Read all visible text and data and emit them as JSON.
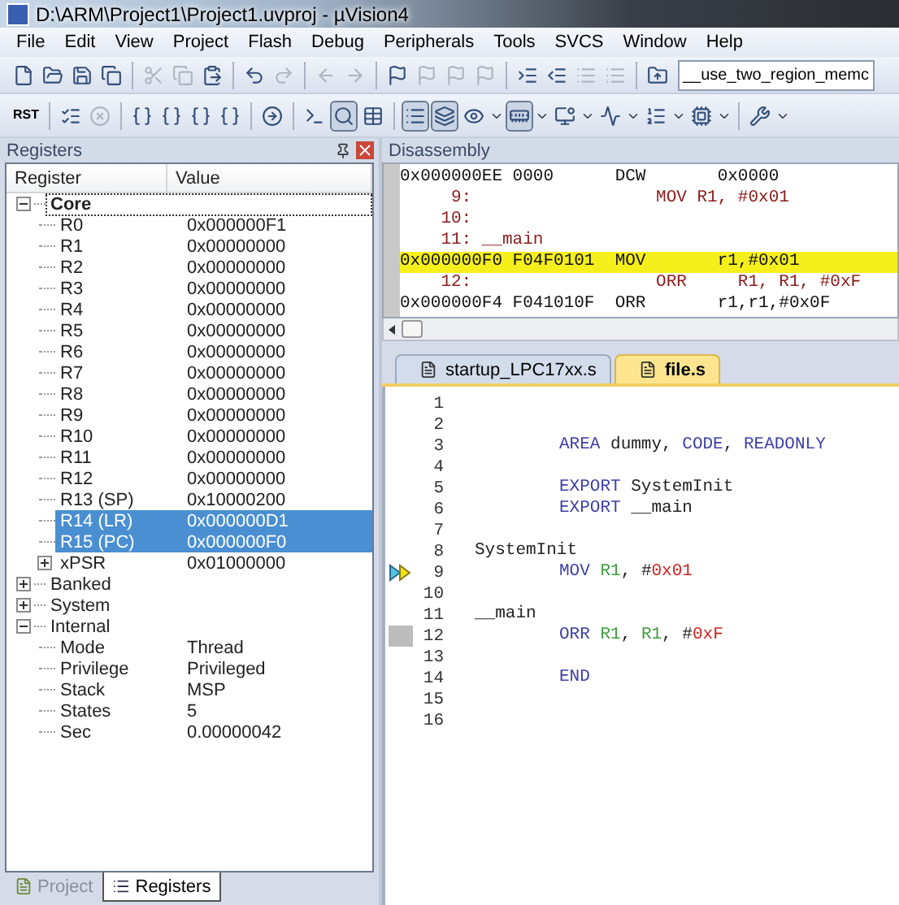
{
  "window": {
    "title": "D:\\ARM\\Project1\\Project1.uvproj - µVision4"
  },
  "menu": [
    "File",
    "Edit",
    "View",
    "Project",
    "Flash",
    "Debug",
    "Peripherals",
    "Tools",
    "SVCS",
    "Window",
    "Help"
  ],
  "toolbar_1": [
    {
      "kind": "new",
      "disabled": false
    },
    {
      "kind": "open",
      "disabled": false
    },
    {
      "kind": "save",
      "disabled": false
    },
    {
      "kind": "save-all",
      "disabled": false
    },
    {
      "kind": "sep"
    },
    {
      "kind": "cut",
      "disabled": true
    },
    {
      "kind": "copy",
      "disabled": true
    },
    {
      "kind": "paste",
      "disabled": false
    },
    {
      "kind": "sep"
    },
    {
      "kind": "undo",
      "disabled": false
    },
    {
      "kind": "redo",
      "disabled": true
    },
    {
      "kind": "sep"
    },
    {
      "kind": "back",
      "disabled": true
    },
    {
      "kind": "forward",
      "disabled": true
    },
    {
      "kind": "sep"
    },
    {
      "kind": "bookmark",
      "disabled": false
    },
    {
      "kind": "bookmark-prev",
      "disabled": true
    },
    {
      "kind": "bookmark-next",
      "disabled": true
    },
    {
      "kind": "bookmark-clear",
      "disabled": true
    },
    {
      "kind": "sep"
    },
    {
      "kind": "indent",
      "disabled": false
    },
    {
      "kind": "unindent",
      "disabled": false
    },
    {
      "kind": "comment",
      "disabled": true
    },
    {
      "kind": "uncomment",
      "disabled": true
    },
    {
      "kind": "sep"
    },
    {
      "kind": "load",
      "disabled": false
    }
  ],
  "target_select": {
    "value": "__use_two_region_memc"
  },
  "toolbar_2": [
    {
      "kind": "reset",
      "label": "RST",
      "disabled": false
    },
    {
      "kind": "sep"
    },
    {
      "kind": "run",
      "disabled": false
    },
    {
      "kind": "stop",
      "disabled": true
    },
    {
      "kind": "sep"
    },
    {
      "kind": "step-into",
      "disabled": false
    },
    {
      "kind": "step-over",
      "disabled": false
    },
    {
      "kind": "step-out",
      "disabled": false
    },
    {
      "kind": "run-to-cursor",
      "disabled": false
    },
    {
      "kind": "sep"
    },
    {
      "kind": "next-statement",
      "disabled": false
    },
    {
      "kind": "sep"
    },
    {
      "kind": "command",
      "disabled": false,
      "pressed": false
    },
    {
      "kind": "disassembly",
      "disabled": false,
      "pressed": true
    },
    {
      "kind": "symbols",
      "disabled": false,
      "pressed": false
    },
    {
      "kind": "sep"
    },
    {
      "kind": "registers",
      "disabled": false,
      "pressed": true
    },
    {
      "kind": "call-stack",
      "disabled": false,
      "pressed": true
    },
    {
      "kind": "watch",
      "disabled": false,
      "pressed": false,
      "dropdown": true
    },
    {
      "kind": "memory",
      "disabled": false,
      "pressed": true,
      "dropdown": true
    },
    {
      "kind": "serial",
      "disabled": false,
      "pressed": false,
      "dropdown": true
    },
    {
      "kind": "analysis",
      "disabled": false,
      "pressed": false,
      "dropdown": true
    },
    {
      "kind": "trace",
      "disabled": false,
      "pressed": false,
      "dropdown": true
    },
    {
      "kind": "system-viewer",
      "disabled": false,
      "pressed": false,
      "dropdown": true
    },
    {
      "kind": "sep"
    },
    {
      "kind": "tools",
      "disabled": false,
      "pressed": false,
      "dropdown": true
    }
  ],
  "registers": {
    "title": "Registers",
    "columns": [
      "Register",
      "Value"
    ],
    "tree": [
      {
        "name": "Core",
        "expanded": true,
        "focused": true,
        "children": [
          {
            "name": "R0",
            "value": "0x000000F1",
            "selected": false
          },
          {
            "name": "R1",
            "value": "0x00000000",
            "selected": false
          },
          {
            "name": "R2",
            "value": "0x00000000",
            "selected": false
          },
          {
            "name": "R3",
            "value": "0x00000000",
            "selected": false
          },
          {
            "name": "R4",
            "value": "0x00000000",
            "selected": false
          },
          {
            "name": "R5",
            "value": "0x00000000",
            "selected": false
          },
          {
            "name": "R6",
            "value": "0x00000000",
            "selected": false
          },
          {
            "name": "R7",
            "value": "0x00000000",
            "selected": false
          },
          {
            "name": "R8",
            "value": "0x00000000",
            "selected": false
          },
          {
            "name": "R9",
            "value": "0x00000000",
            "selected": false
          },
          {
            "name": "R10",
            "value": "0x00000000",
            "selected": false
          },
          {
            "name": "R11",
            "value": "0x00000000",
            "selected": false
          },
          {
            "name": "R12",
            "value": "0x00000000",
            "selected": false
          },
          {
            "name": "R13 (SP)",
            "value": "0x10000200",
            "selected": false
          },
          {
            "name": "R14 (LR)",
            "value": "0x000000D1",
            "selected": true
          },
          {
            "name": "R15 (PC)",
            "value": "0x000000F0",
            "selected": true
          },
          {
            "name": "xPSR",
            "value": "0x01000000",
            "selected": false,
            "expanded": false
          }
        ]
      },
      {
        "name": "Banked",
        "expanded": false
      },
      {
        "name": "System",
        "expanded": false
      },
      {
        "name": "Internal",
        "expanded": true,
        "children": [
          {
            "name": "Mode",
            "value": "Thread",
            "selected": false
          },
          {
            "name": "Privilege",
            "value": "Privileged",
            "selected": false
          },
          {
            "name": "Stack",
            "value": "MSP",
            "selected": false
          },
          {
            "name": "States",
            "value": "5",
            "selected": false
          },
          {
            "name": "Sec",
            "value": "0.00000042",
            "selected": false
          }
        ]
      }
    ]
  },
  "left_tabs": [
    {
      "label": "Project",
      "selected": false,
      "kind": "project"
    },
    {
      "label": "Registers",
      "selected": true,
      "kind": "registers"
    }
  ],
  "disassembly": {
    "title": "Disassembly",
    "lines": [
      {
        "kind": "address",
        "text": "0x000000EE 0000      DCW       0x0000",
        "current": false
      },
      {
        "kind": "source",
        "text": "     9:                  MOV R1, #0x01",
        "current": false
      },
      {
        "kind": "source",
        "text": "    10:",
        "current": false
      },
      {
        "kind": "source",
        "text": "    11: __main",
        "current": false
      },
      {
        "kind": "address",
        "text": "0x000000F0 F04F0101  MOV       r1,#0x01",
        "current": true
      },
      {
        "kind": "source",
        "text": "    12:                  ORR     R1, R1, #0xF",
        "current": false
      },
      {
        "kind": "address",
        "text": "0x000000F4 F041010F  ORR       r1,r1,#0x0F",
        "current": false
      }
    ]
  },
  "editor_tabs": [
    {
      "label": "startup_LPC17xx.s",
      "selected": false
    },
    {
      "label": "file.s",
      "selected": true
    }
  ],
  "editor": [
    {
      "number": "1"
    },
    {
      "number": "2"
    },
    {
      "number": "3",
      "indent": true,
      "tokens": [
        {
          "text": "AREA",
          "kind": "keyword"
        },
        {
          "text": " dummy, ",
          "kind": "plain"
        },
        {
          "text": "CODE",
          "kind": "keyword"
        },
        {
          "text": ", ",
          "kind": "plain"
        },
        {
          "text": "READONLY",
          "kind": "keyword"
        }
      ]
    },
    {
      "number": "4"
    },
    {
      "number": "5",
      "indent": true,
      "tokens": [
        {
          "text": "EXPORT",
          "kind": "keyword"
        },
        {
          "text": " SystemInit",
          "kind": "plain"
        }
      ]
    },
    {
      "number": "6",
      "indent": true,
      "tokens": [
        {
          "text": "EXPORT",
          "kind": "keyword"
        },
        {
          "text": " __main",
          "kind": "plain"
        }
      ]
    },
    {
      "number": "7"
    },
    {
      "number": "8",
      "tokens": [
        {
          "text": "SystemInit",
          "kind": "plain"
        }
      ]
    },
    {
      "number": "9",
      "current": true,
      "indent": true,
      "tokens": [
        {
          "text": "MOV ",
          "kind": "keyword"
        },
        {
          "text": "R1",
          "kind": "register"
        },
        {
          "text": ", ",
          "kind": "plain"
        },
        {
          "text": "#",
          "kind": "plain"
        },
        {
          "text": "0x01",
          "kind": "number"
        }
      ]
    },
    {
      "number": "10"
    },
    {
      "number": "11",
      "tokens": [
        {
          "text": "__main",
          "kind": "plain"
        }
      ]
    },
    {
      "number": "12",
      "executed": true,
      "indent": true,
      "tokens": [
        {
          "text": "ORR ",
          "kind": "keyword"
        },
        {
          "text": "R1",
          "kind": "register"
        },
        {
          "text": ", ",
          "kind": "plain"
        },
        {
          "text": "R1",
          "kind": "register"
        },
        {
          "text": ", ",
          "kind": "plain"
        },
        {
          "text": "#",
          "kind": "plain"
        },
        {
          "text": "0xF",
          "kind": "number"
        }
      ]
    },
    {
      "number": "13"
    },
    {
      "number": "14",
      "indent": true,
      "tokens": [
        {
          "text": "END",
          "kind": "keyword"
        }
      ]
    },
    {
      "number": "15"
    },
    {
      "number": "16"
    }
  ]
}
